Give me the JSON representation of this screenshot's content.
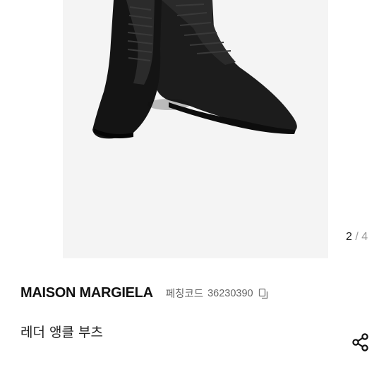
{
  "gallery": {
    "current": "2",
    "separator": "/",
    "total": "4",
    "image_subject": "boot-image"
  },
  "product": {
    "brand": "MAISON MARGIELA",
    "code_label": "페칭코드",
    "code_value": "36230390",
    "name": "레더 앵클 부츠"
  },
  "icons": {
    "copy": "copy-icon",
    "share": "share-icon"
  }
}
